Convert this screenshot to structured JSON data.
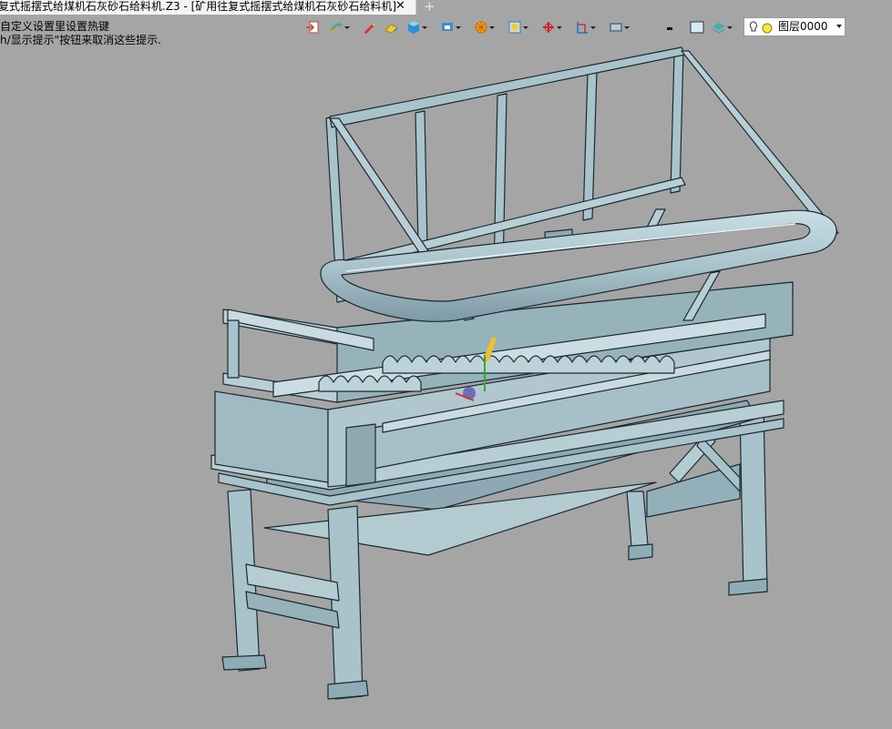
{
  "tab": {
    "title": "复式摇摆式给煤机石灰砂石给料机.Z3 - [矿用往复式摇摆式给煤机石灰砂石给料机]",
    "close": "✕",
    "new_tab": "+"
  },
  "hints": [
    "自定义设置里设置热键",
    "h/显示提示\"按钮来取消这些提示."
  ],
  "toolbar": {
    "icons": [
      "exit-view-icon",
      "shading-icon",
      "pencil-icon",
      "wedge-icon",
      "cube-view-icon",
      "display-mode-icon",
      "wheel-icon",
      "render-icon",
      "axis-icon",
      "frame-icon",
      "screen-icon",
      "monitor-icon",
      "line-color-icon",
      "fill-color-icon",
      "layer-stack-icon"
    ]
  },
  "layer_selector": {
    "value": "图层0000"
  },
  "colors": {
    "background": "#a5a5a5",
    "model": "#a9c3cc",
    "edge": "#1b2a30"
  }
}
